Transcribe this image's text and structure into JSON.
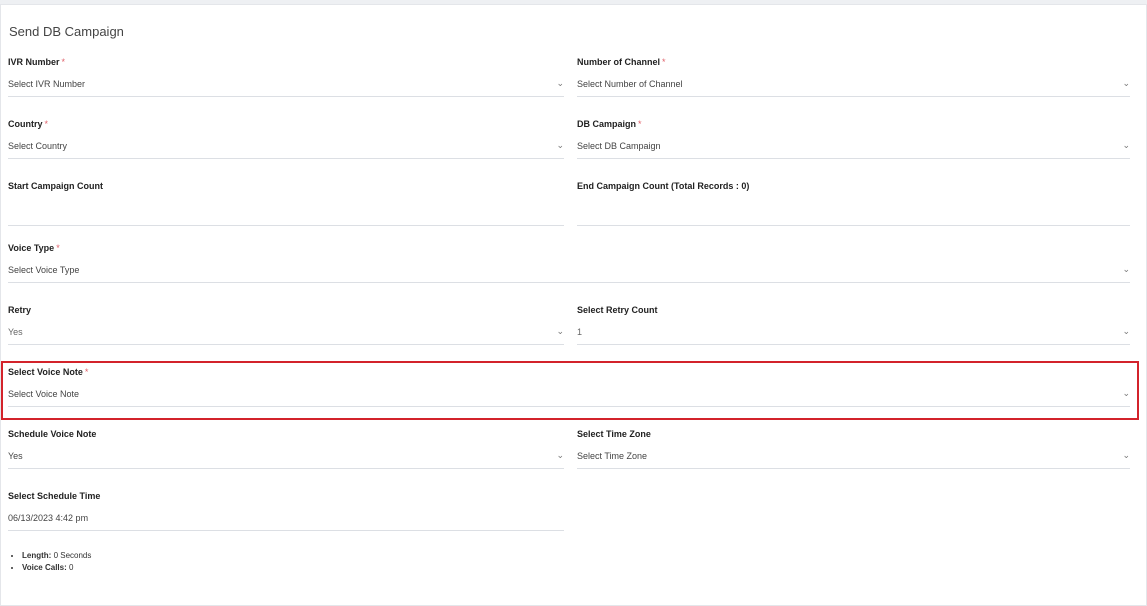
{
  "page": {
    "title": "Send DB Campaign"
  },
  "fields": {
    "ivr_number": {
      "label": "IVR Number",
      "value": "Select IVR Number"
    },
    "number_of_channel": {
      "label": "Number of Channel",
      "value": "Select Number of Channel"
    },
    "country": {
      "label": "Country",
      "value": "Select Country"
    },
    "db_campaign": {
      "label": "DB Campaign",
      "value": "Select DB Campaign"
    },
    "start_campaign_count": {
      "label": "Start Campaign Count",
      "value": ""
    },
    "end_campaign_count": {
      "label": "End Campaign Count (Total Records : 0)",
      "value": ""
    },
    "voice_type": {
      "label": "Voice Type",
      "value": "Select Voice Type"
    },
    "retry": {
      "label": "Retry",
      "value": "Yes"
    },
    "retry_count": {
      "label": "Select Retry Count",
      "value": "1"
    },
    "voice_note": {
      "label": "Select Voice Note",
      "value": "Select Voice Note"
    },
    "schedule_voice_note": {
      "label": "Schedule Voice Note",
      "value": "Yes"
    },
    "time_zone": {
      "label": "Select Time Zone",
      "value": "Select Time Zone"
    },
    "schedule_time": {
      "label": "Select Schedule Time",
      "value": "06/13/2023 4:42 pm"
    }
  },
  "required_mark": "*",
  "dropdown_icon": "chevron-down-icon",
  "stats": [
    {
      "label": "Length:",
      "value": "0 Seconds"
    },
    {
      "label": "Voice Calls:",
      "value": "0"
    }
  ],
  "colors": {
    "highlight": "#d3232b",
    "required": "#e0626b"
  }
}
